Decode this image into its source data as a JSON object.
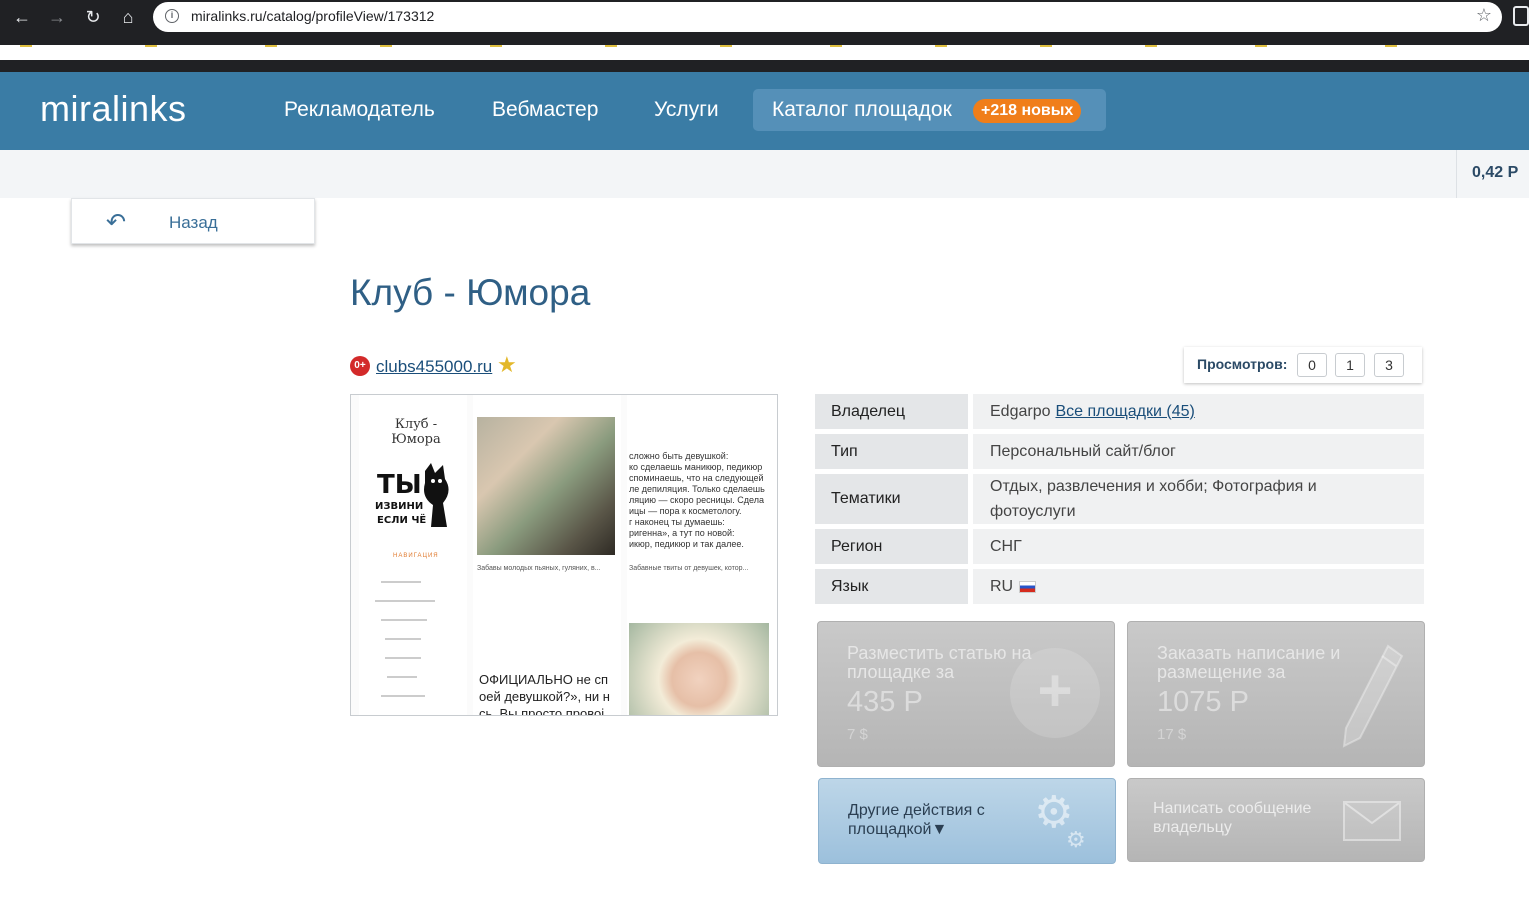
{
  "browser": {
    "url": "miralinks.ru/catalog/profileView/173312"
  },
  "header": {
    "logo": "miralinks",
    "menu": [
      {
        "label": "Рекламодатель"
      },
      {
        "label": "Вебмастер"
      },
      {
        "label": "Услуги"
      }
    ],
    "active_menu": {
      "label": "Каталог площадок",
      "badge": "+218 новых"
    },
    "balance": "0,42 Р"
  },
  "back": {
    "label": "Назад"
  },
  "page": {
    "title": "Клуб - Юмора",
    "age_rating": "0+",
    "site_link": "clubs455000.ru",
    "views_label": "Просмотров:",
    "views": [
      "0",
      "1",
      "3"
    ]
  },
  "thumbnail": {
    "site_title": "Клуб - Юмора",
    "logo_text": "ТЫ ИЗВИНИ ЕСЛИ ЧЁ",
    "nav_label": "НАВИГАЦИЯ",
    "excerpt": "сложно быть девушкой:\nко сделаешь маникюр, педикюр\nспоминаешь, что на следующей\nле депиляция. Только сделаешь\nляцию — скоро ресницы. Сдела\nицы — пора к косметологу.\nг наконец ты думаешь:\nригенна», а тут по новой:\nикюр, педикюр и так далее.",
    "caption1": "Забавы молодых пьяных, гуляних, в...",
    "caption2": "Забавные твиты от девушек, котор...",
    "big_text": "ОФИЦИАЛЬНО не сп\nоей девушкой?», ни н\nсь. Вы просто провоі"
  },
  "info": [
    {
      "key": "Владелец",
      "value": "Edgarpo",
      "link": "Все площадки (45)"
    },
    {
      "key": "Тип",
      "value": "Персональный сайт/блог"
    },
    {
      "key": "Тематики",
      "value": "Отдых, развлечения и хобби; Фотография и фотоуслуги"
    },
    {
      "key": "Регион",
      "value": "СНГ"
    },
    {
      "key": "Язык",
      "value": "RU"
    }
  ],
  "actions": {
    "place_article": {
      "title": "Разместить статью на площадке за",
      "price": "435 Р",
      "usd": "7 $"
    },
    "order_writing": {
      "title": "Заказать написание и размещение за",
      "price": "1075 Р",
      "usd": "17 $"
    },
    "other_actions": {
      "title": "Другие действия с площадкой▼"
    },
    "message_owner": {
      "title": "Написать сообщение владельцу"
    }
  },
  "colors": {
    "header_bg": "#3a7ca5",
    "badge_orange": "#f07e1a",
    "title_blue": "#2f5f85",
    "link_blue": "#1a4e7a"
  }
}
